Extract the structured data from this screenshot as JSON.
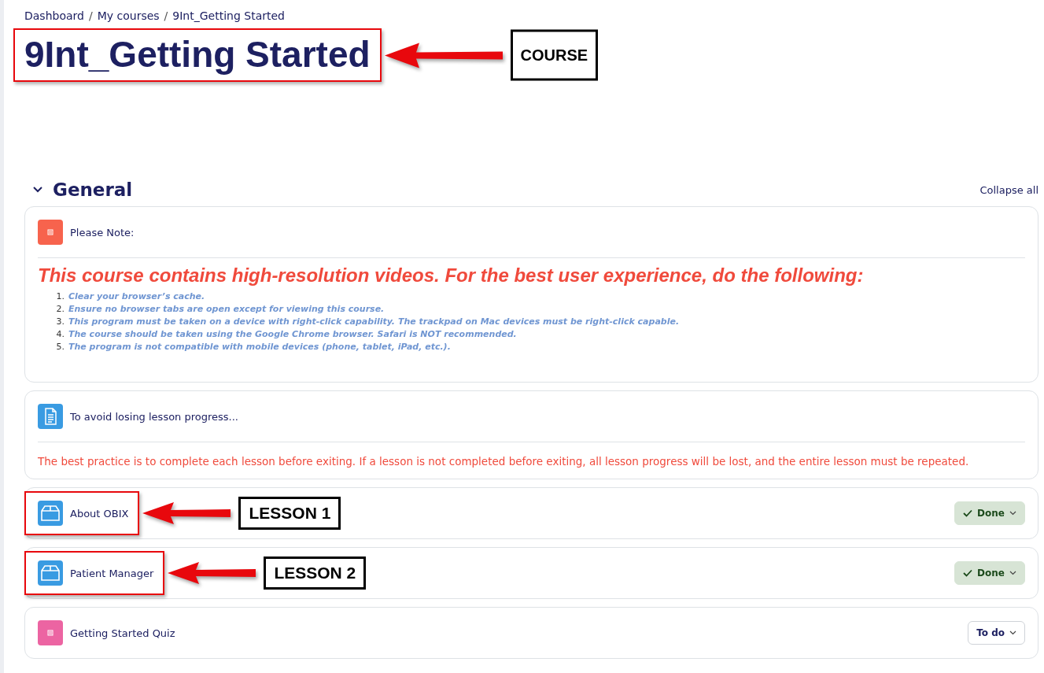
{
  "breadcrumb": {
    "separator": "/",
    "items": [
      "Dashboard",
      "My courses",
      "9Int_Getting Started"
    ]
  },
  "course_title": {
    "text": "9Int_Getting Started",
    "callout": "COURSE"
  },
  "section": {
    "title": "General",
    "expanded": true,
    "collapse_all": "Collapse all",
    "activities": [
      {
        "kind": "label",
        "name": "Please Note:",
        "heading": "This course contains high-resolution videos.  For the best user experience, do the following:",
        "steps": [
          {
            "number": "1.",
            "text": "Clear your browser’s cache."
          },
          {
            "number": "2.",
            "text": "Ensure no browser tabs are open except for viewing this course."
          },
          {
            "number": "3.",
            "text": "This program must be taken on a device with right-click capability.  The trackpad on Mac devices must be right-click capable."
          },
          {
            "number": "4.",
            "text": "The course should be taken using the Google Chrome browser.  Safari is NOT recommended."
          },
          {
            "number": "5.",
            "text": "The program is not compatible with mobile devices (phone, tablet, iPad, etc.)."
          }
        ]
      },
      {
        "kind": "page",
        "name": "To avoid losing lesson progress...",
        "body": "The best practice is to complete each lesson before exiting.  If a lesson is not completed before exiting, all lesson progress will be lost, and the entire lesson must be repeated."
      },
      {
        "kind": "lesson",
        "name": "About OBIX",
        "callout": "LESSON 1",
        "status": {
          "label": "Done",
          "done": true
        }
      },
      {
        "kind": "lesson",
        "name": "Patient Manager",
        "callout": "LESSON 2",
        "status": {
          "label": "Done",
          "done": true
        }
      },
      {
        "kind": "quiz",
        "name": "Getting Started Quiz",
        "status": {
          "label": "To do",
          "done": false
        }
      }
    ]
  }
}
